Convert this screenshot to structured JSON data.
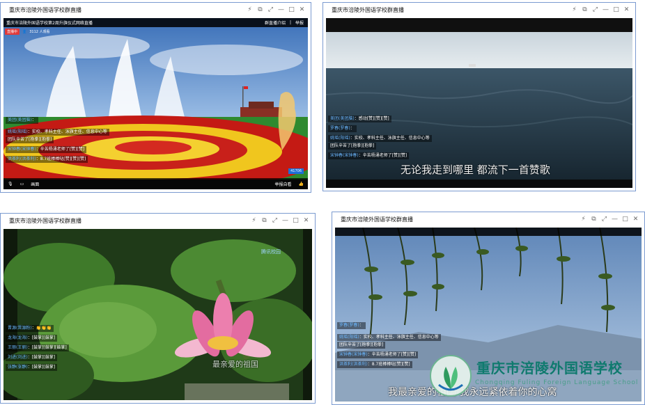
{
  "windows": [
    {
      "title": "重庆市涪陵外国语学校群直播",
      "stream_title": "重庆市涪陵外国语学校第2周升旗仪式网络直播",
      "top_right": [
        "群直播介绍",
        "|",
        "举报"
      ],
      "live_badge": "直播中",
      "viewers_text": "3112 人观看",
      "chat": [
        {
          "user": "美团(美团脑)",
          "text": "："
        },
        {
          "user": "姚瑶(阳瑶)",
          "text": "：实校、孝科主任、泳旗主任、信息中心等"
        },
        {
          "user": "",
          "text": "团队辛苦了[抱拳][抱拳]"
        },
        {
          "user": "宋钟春(宋钟春)",
          "text": "：辛苦杨涌老师了[赞][赞]"
        },
        {
          "user": "洪茶利(洪茶利)",
          "text": "：8.7班棒棒哒[赞][赞][赞]"
        }
      ],
      "view_count": "41706",
      "bottom_labels": [
        "",
        "",
        "画面",
        "举报自看"
      ]
    },
    {
      "title": "重庆市涪陵外国语学校群直播",
      "chat": [
        {
          "user": "美团(美团脑)",
          "text": "：感动[赞][赞][赞]"
        },
        {
          "user": "罗春(罗春)",
          "text": "："
        },
        {
          "user": "姚瑶(阳瑶)",
          "text": "：实校、孝科主任、泳旗主任、信息中心等"
        },
        {
          "user": "",
          "text": "团队辛苦了[抱拳][抱拳]"
        },
        {
          "user": "宋钟春(宋钟春)",
          "text": "：辛苦杨涌老师了[赞][赞]"
        }
      ],
      "subtitle": "无论我走到哪里  都流下一首赞歌"
    },
    {
      "title": "重庆市涪陵外国语学校群直播",
      "watermark": "腾讯校园",
      "chat": [
        {
          "user": "晋源(晋源粉)",
          "text": "：👏👏👏"
        },
        {
          "user": "龙海(龙海)",
          "text": "：[鼓掌][鼓掌]"
        },
        {
          "user": "王丽(王丽)",
          "text": "：[鼓掌][鼓掌][鼓掌]"
        },
        {
          "user": "刘进(刘进)",
          "text": "：[鼓掌][鼓掌]"
        },
        {
          "user": "张静(张静)",
          "text": "：[鼓掌][鼓掌]"
        }
      ],
      "subtitle": "最亲爱的祖国"
    },
    {
      "title": "重庆市涪陵外国语学校群直播",
      "chat": [
        {
          "user": "罗春(罗春)",
          "text": "："
        },
        {
          "user": "姚瑶(阳瑶)",
          "text": "：实校、孝科主任、泳旗主任、信息中心等"
        },
        {
          "user": "",
          "text": "团队辛苦了[抱拳][抱拳]"
        },
        {
          "user": "宋钟春(宋钟春)",
          "text": "：辛苦杨涌老师了[赞][赞]"
        },
        {
          "user": "洪茶利(洪茶利)",
          "text": "：8.7班棒棒哒[赞][赞]"
        }
      ],
      "subtitle": "我最亲爱的祖国  我永远紧依着你的心窝"
    }
  ],
  "window_controls": [
    "⚡",
    "⧉",
    "⤢",
    "—",
    "□",
    "✕"
  ],
  "school_logo": {
    "name_cn": "重庆市涪陵外国语学校",
    "name_en": "Chongqing Fuling Foreign Language School"
  },
  "colors": {
    "title_border": "#7a9ad0",
    "logo_green": "#0f7a6e",
    "chat_user": "#6cb8ff",
    "live_badge": "#e03a3a"
  }
}
